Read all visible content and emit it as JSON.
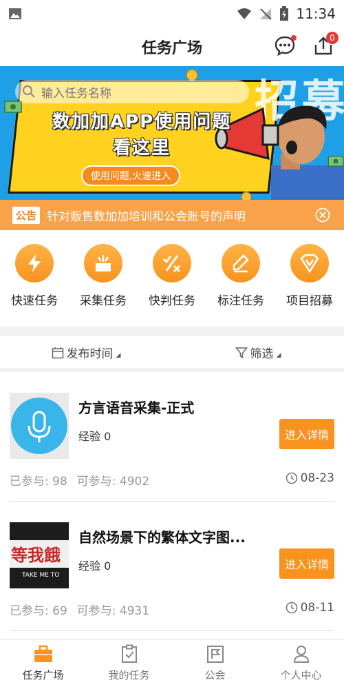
{
  "status_bar": {
    "time": "11:34"
  },
  "header": {
    "title": "任务广场",
    "upload_badge": "0"
  },
  "banner": {
    "search_placeholder": "输入任务名称",
    "headline1": "数加加APP使用问题",
    "headline2": "看这里",
    "button_label": "使用问题,火速进入",
    "bg_text": "招募"
  },
  "notice": {
    "tag": "公告",
    "text": "针对贩售数加加培训和公会账号的声明"
  },
  "categories": [
    {
      "label": "快速任务",
      "icon": "lightning-icon"
    },
    {
      "label": "采集任务",
      "icon": "collect-icon"
    },
    {
      "label": "快判任务",
      "icon": "judge-icon"
    },
    {
      "label": "标注任务",
      "icon": "pencil-icon"
    },
    {
      "label": "项目招募",
      "icon": "v-badge-icon"
    }
  ],
  "filters": {
    "time": "发布时间",
    "filter": "筛选"
  },
  "tasks": [
    {
      "name": "方言语音采集-正式",
      "exp": "经验 0",
      "button": "进入详情",
      "joined": "已参与: 98",
      "available": "可参与: 4902",
      "date": "08-23"
    },
    {
      "name": "自然场景下的繁体文字图...",
      "exp": "经验 0",
      "button": "进入详情",
      "joined": "已参与: 69",
      "available": "可参与: 4931",
      "date": "08-11",
      "thumb_text": "等我餓",
      "thumb_sub": "TAKE ME TO"
    }
  ],
  "bottom_nav": [
    {
      "label": "任务广场",
      "active": true
    },
    {
      "label": "我的任务",
      "active": false
    },
    {
      "label": "公会",
      "active": false
    },
    {
      "label": "个人中心",
      "active": false
    }
  ],
  "colors": {
    "accent": "#f7931e",
    "banner_blue": "#1fa0e6",
    "notice_bg": "#f9a24a"
  }
}
